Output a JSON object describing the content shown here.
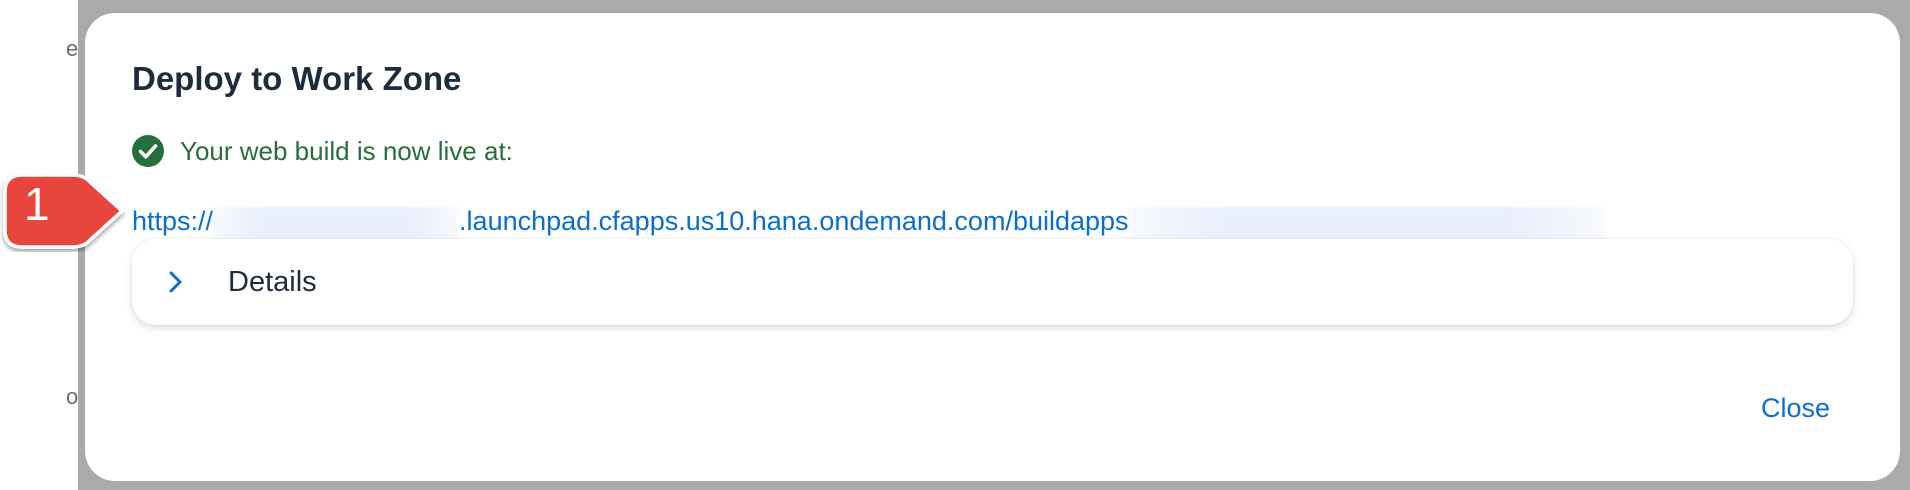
{
  "background": {
    "fragment_top": "e",
    "fragment_bottom": "o"
  },
  "dialog": {
    "title": "Deploy to Work Zone",
    "success_message": "Your web build is now live at:",
    "url": {
      "prefix": "https://",
      "middle": ".launchpad.cfapps.us10.hana.ondemand.com/buildapps"
    },
    "details_label": "Details",
    "close_label": "Close"
  },
  "annotation": {
    "callout_number": "1"
  },
  "icons": {
    "success": "check-circle-icon",
    "expand": "chevron-right-icon"
  },
  "colors": {
    "success": "#256f3a",
    "link": "#0a6ed1",
    "title": "#1d2d3e",
    "callout": "#e8453c"
  }
}
